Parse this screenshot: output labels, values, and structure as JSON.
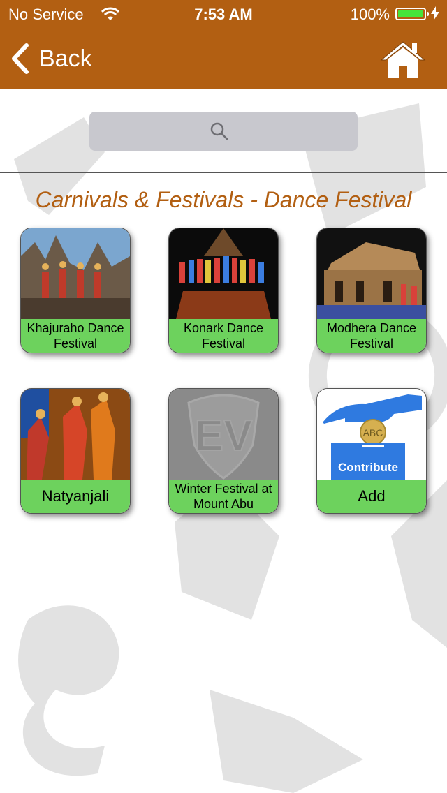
{
  "status_bar": {
    "carrier": "No Service",
    "time": "7:53 AM",
    "battery": "100%"
  },
  "nav": {
    "back_label": "Back"
  },
  "section_title": "Carnivals & Festivals - Dance Festival",
  "tiles": [
    {
      "label": "Khajuraho Dance Festival"
    },
    {
      "label": "Konark Dance Festival"
    },
    {
      "label": "Modhera Dance Festival"
    },
    {
      "label": "Natyanjali"
    },
    {
      "label": "Winter Festival at Mount Abu"
    },
    {
      "label": "Add"
    }
  ],
  "contribute": {
    "label": "Contribute",
    "coin_text": "ABC"
  },
  "placeholder_logo": "EV",
  "colors": {
    "nav": "#b25f12",
    "caption": "#6dd25d",
    "title": "#b25f12"
  }
}
